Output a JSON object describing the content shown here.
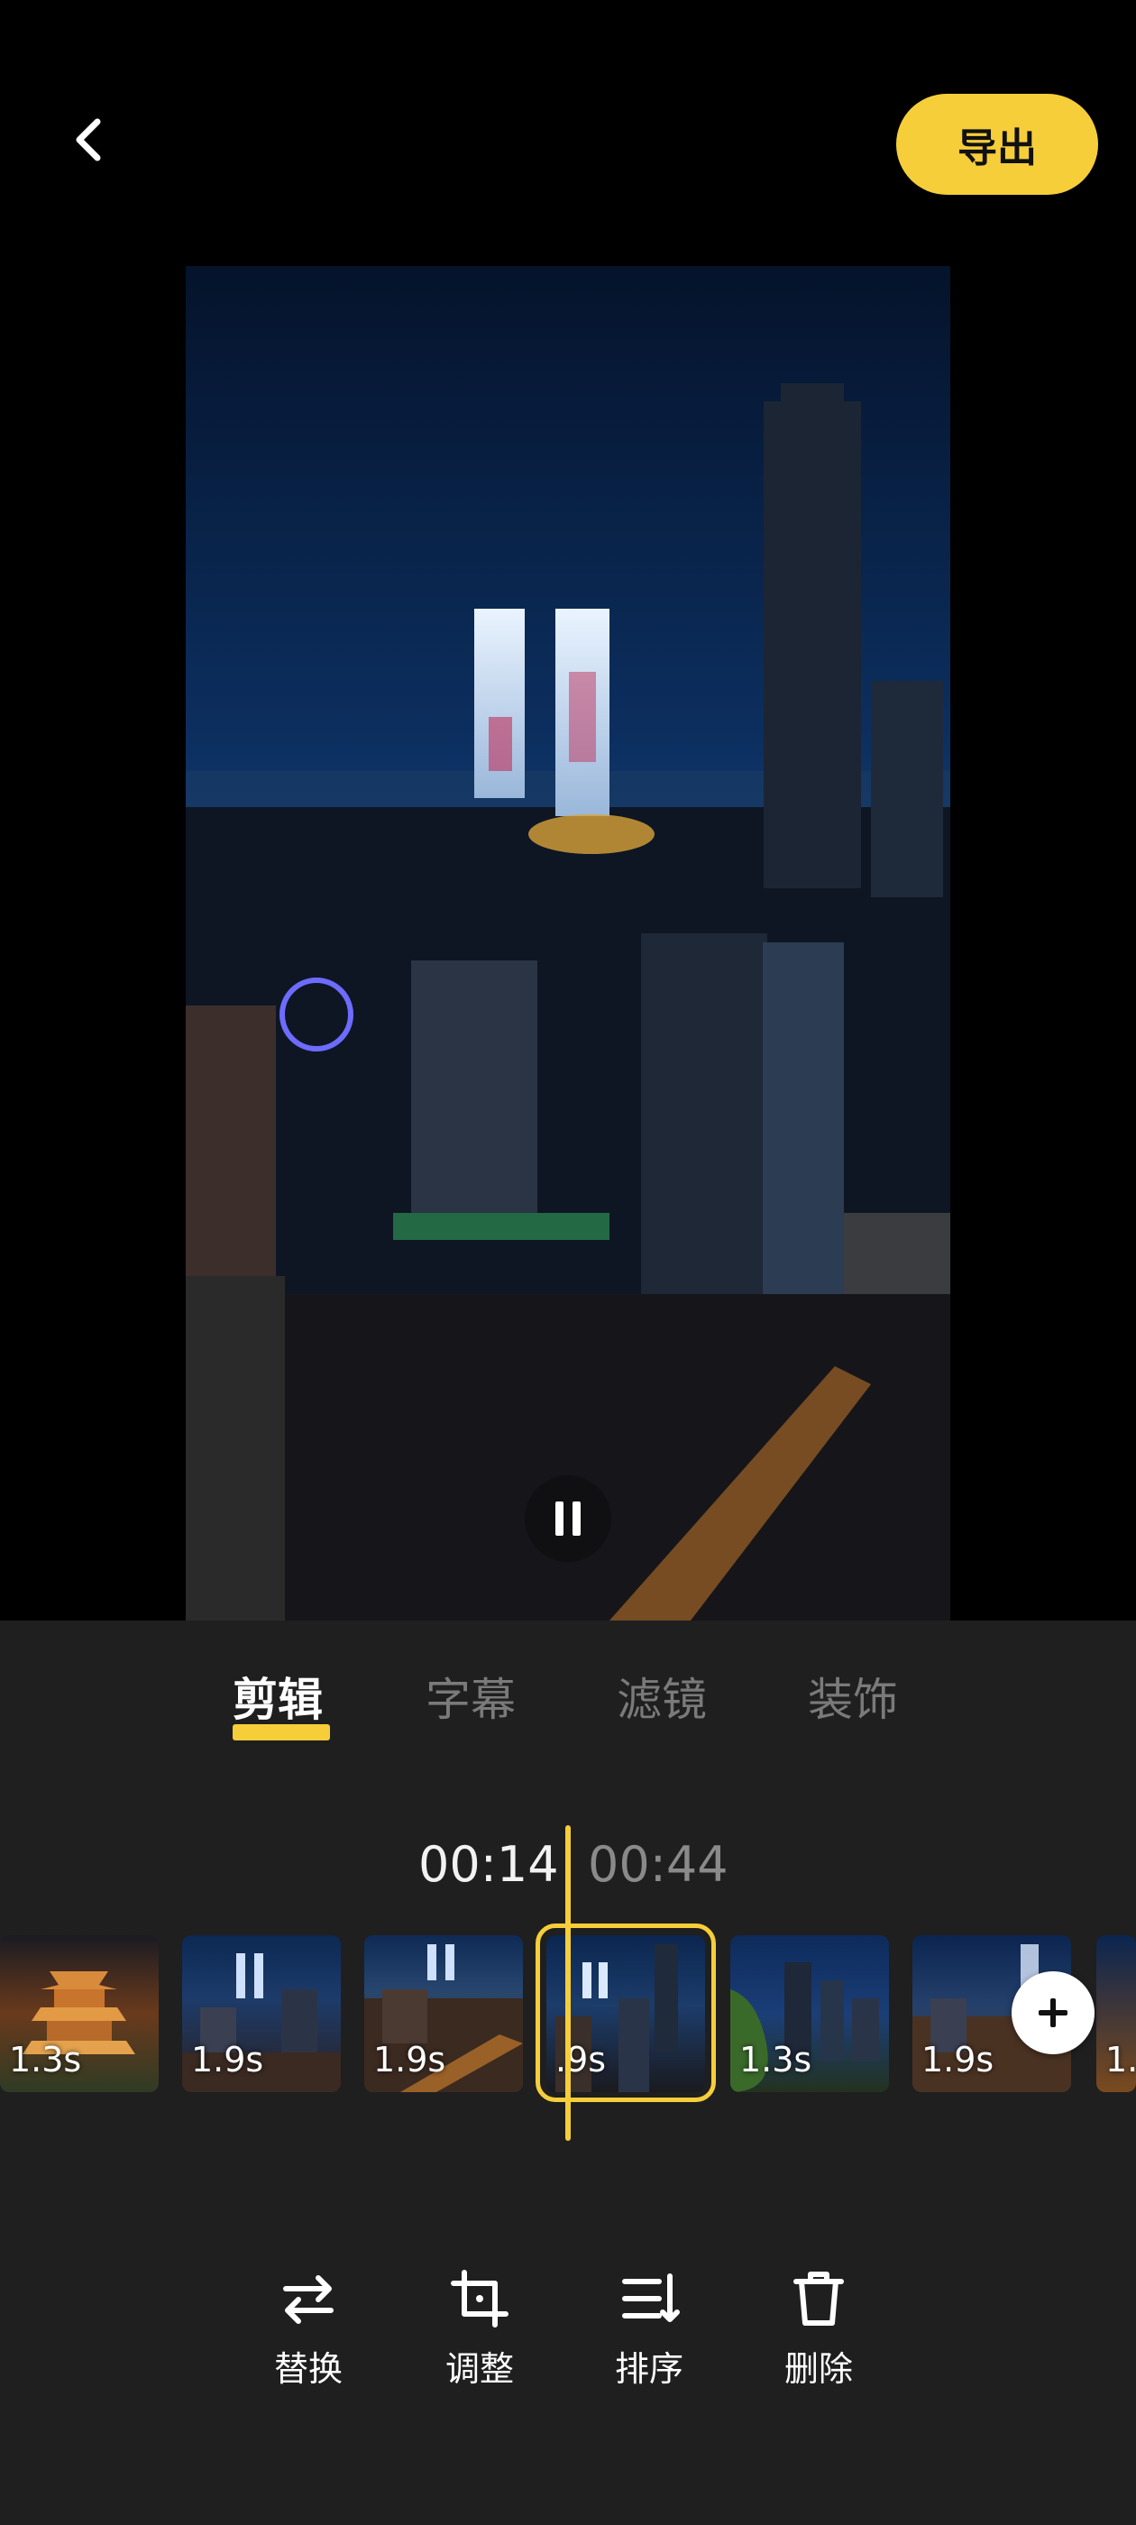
{
  "header": {
    "export_label": "导出"
  },
  "tabs": [
    {
      "label": "剪辑",
      "active": true
    },
    {
      "label": "字幕",
      "active": false
    },
    {
      "label": "滤镜",
      "active": false
    },
    {
      "label": "装饰",
      "active": false
    }
  ],
  "timeline": {
    "current_time": "00:14",
    "total_time": "00:44",
    "clips": [
      {
        "duration": "1.3s",
        "theme": "pagoda"
      },
      {
        "duration": "1.9s",
        "theme": "city-night"
      },
      {
        "duration": "1.9s",
        "theme": "city-street"
      },
      {
        "duration": ".9s",
        "theme": "city-towers",
        "selected": true
      },
      {
        "duration": "1.3s",
        "theme": "skyline-trees"
      },
      {
        "duration": "1.9s",
        "theme": "city-night"
      },
      {
        "duration": "1.",
        "theme": "city-orange"
      }
    ]
  },
  "tools": [
    {
      "label": "替换",
      "icon": "swap-icon"
    },
    {
      "label": "调整",
      "icon": "crop-icon"
    },
    {
      "label": "排序",
      "icon": "sort-icon"
    },
    {
      "label": "删除",
      "icon": "trash-icon"
    }
  ],
  "colors": {
    "accent": "#F6CE3A",
    "panel": "#1F1F1F",
    "background": "#000000"
  }
}
